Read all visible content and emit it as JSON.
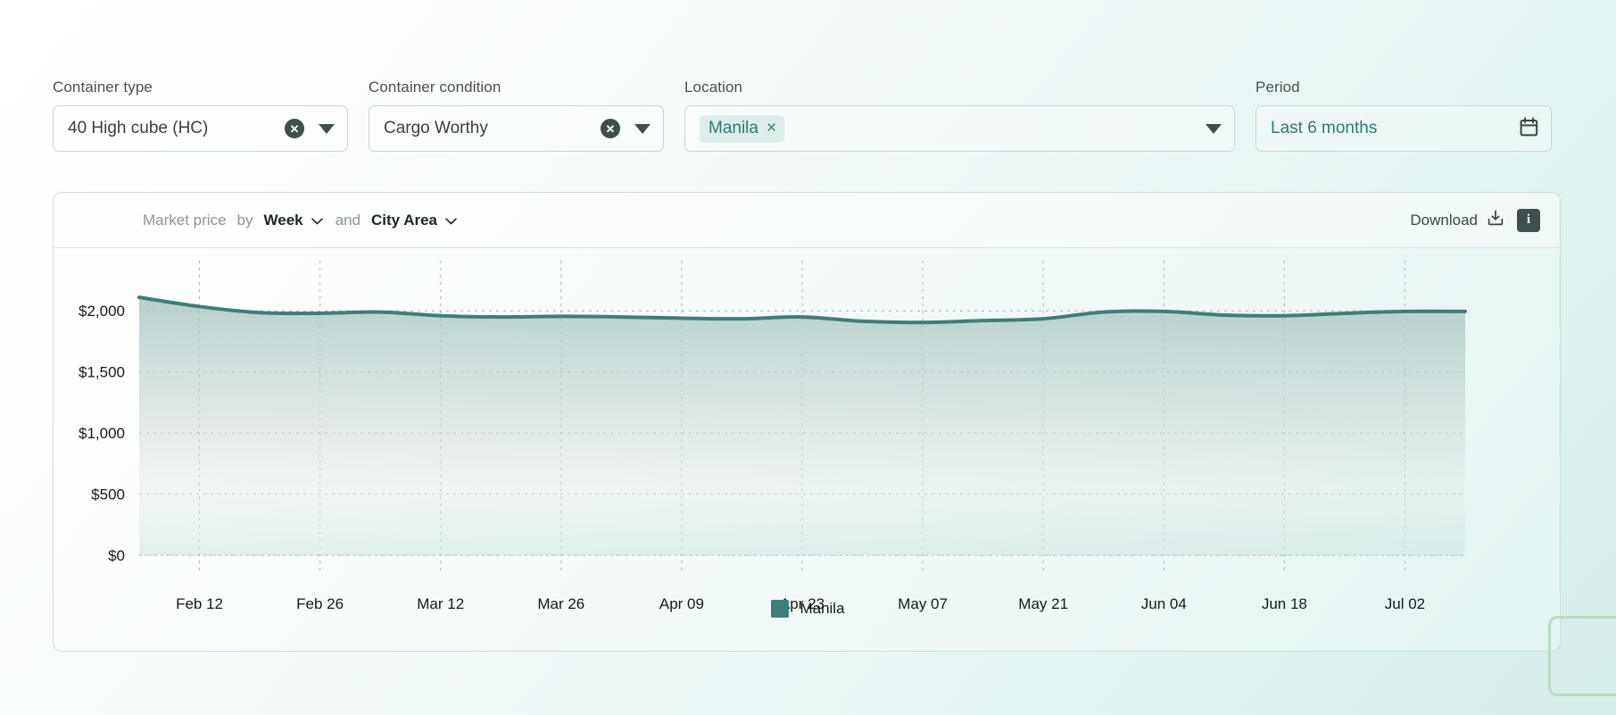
{
  "filters": [
    {
      "id": "container-type",
      "label": "Container type",
      "value": "40 High cube (HC)",
      "clear_icon": "clear-circle-icon",
      "caret_icon": "chevron-down-icon"
    },
    {
      "id": "container-condition",
      "label": "Container condition",
      "value": "Cargo Worthy",
      "clear_icon": "clear-circle-icon",
      "caret_icon": "chevron-down-icon"
    },
    {
      "id": "location",
      "label": "Location",
      "value": "Manila",
      "chip_remove": "×",
      "caret_icon": "chevron-down-icon"
    },
    {
      "id": "period",
      "label": "Period",
      "value": "Last 6 months",
      "calendar_icon": "calendar-icon"
    }
  ],
  "toolbar": {
    "metric_label": "Market price",
    "by_label": "by",
    "granularity": "Week",
    "and_label": "and",
    "grouping": "City Area",
    "download_label": "Download",
    "download_icon": "download-icon",
    "info_label": "i",
    "info_icon": "info-icon",
    "chevron_icon": "chevron-down-icon"
  },
  "colors": {
    "series": "#3d7f78",
    "accent": "#2f7a70",
    "dark": "#3f4f4d",
    "grid": "#9aa5a3"
  },
  "chart_data": {
    "type": "area",
    "title": "Market price by Week and City Area",
    "xlabel": "",
    "ylabel": "",
    "ylim": [
      0,
      2250
    ],
    "yticks": [
      0,
      500,
      1000,
      1500,
      2000
    ],
    "ytick_labels": [
      "$0",
      "$500",
      "$1,000",
      "$1,500",
      "$2,000"
    ],
    "grid": true,
    "legend_position": "bottom",
    "xtick_labels": [
      "Feb 12",
      "Feb 26",
      "Mar 12",
      "Mar 26",
      "Apr 09",
      "Apr 23",
      "May 07",
      "May 21",
      "Jun 04",
      "Jun 18",
      "Jul 02"
    ],
    "x": [
      "Feb 05",
      "Feb 12",
      "Feb 19",
      "Feb 26",
      "Mar 05",
      "Mar 12",
      "Mar 19",
      "Mar 26",
      "Apr 02",
      "Apr 09",
      "Apr 16",
      "Apr 23",
      "Apr 30",
      "May 07",
      "May 14",
      "May 21",
      "May 28",
      "Jun 04",
      "Jun 11",
      "Jun 18",
      "Jun 25",
      "Jul 02",
      "Jul 09"
    ],
    "series": [
      {
        "name": "Manila",
        "color": "#3d7f78",
        "values": [
          2110,
          2035,
          1985,
          1980,
          1990,
          1960,
          1950,
          1955,
          1950,
          1940,
          1935,
          1950,
          1915,
          1905,
          1920,
          1935,
          1990,
          1995,
          1965,
          1960,
          1980,
          1995,
          1995
        ]
      }
    ],
    "legend": [
      {
        "label": "Manila",
        "color": "#3d7f78"
      }
    ]
  }
}
